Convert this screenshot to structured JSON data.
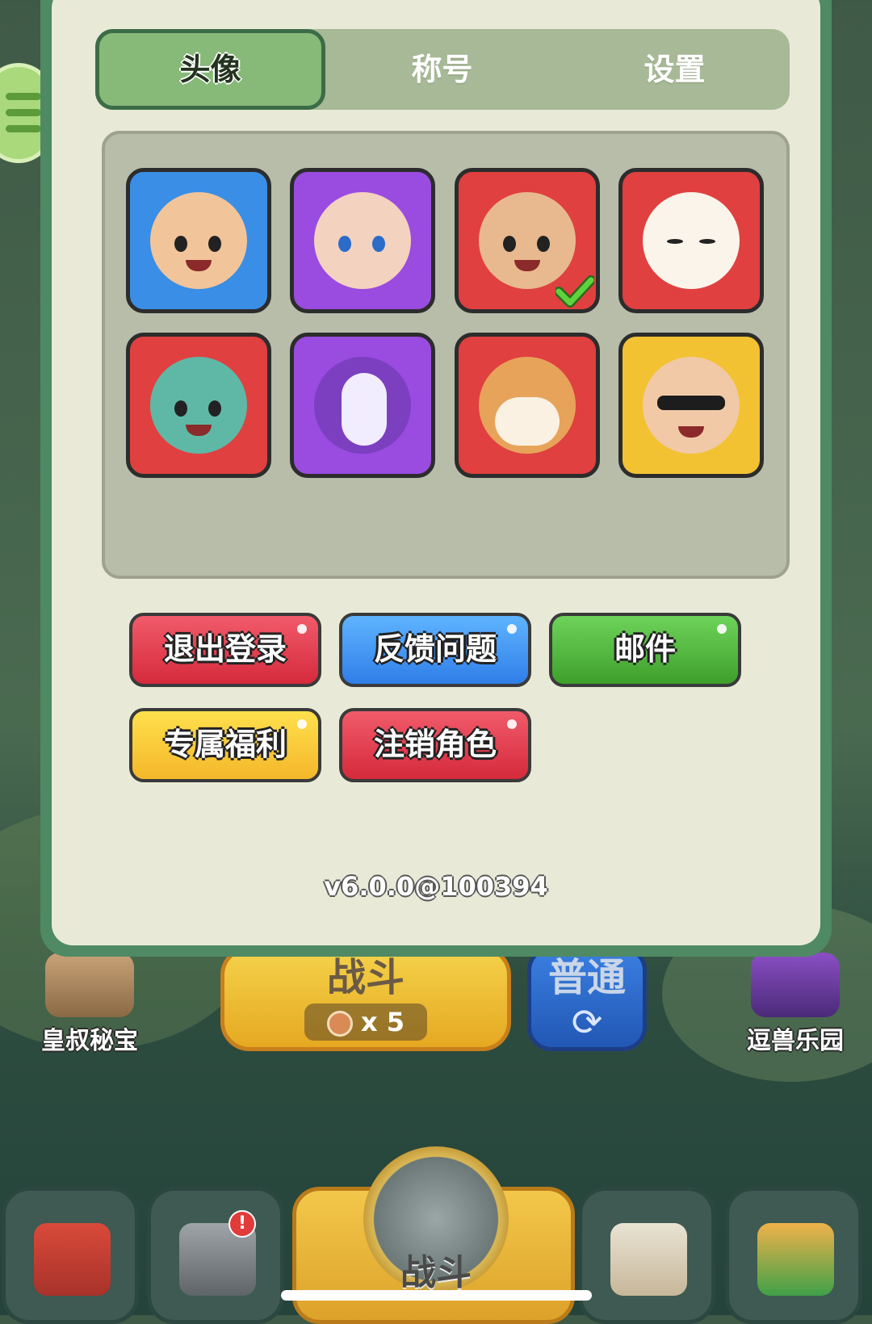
{
  "tabs": [
    {
      "label": "头像",
      "active": true
    },
    {
      "label": "称号",
      "active": false
    },
    {
      "label": "设置",
      "active": false
    }
  ],
  "avatars": [
    {
      "name": "general-green-headband",
      "bg": "#3a8ee6",
      "selected": false
    },
    {
      "name": "purple-hair-heroine",
      "bg": "#9a4be0",
      "selected": false
    },
    {
      "name": "red-horned-warrior",
      "bg": "#e04040",
      "selected": true
    },
    {
      "name": "lucky-cat",
      "bg": "#e04040",
      "selected": false
    },
    {
      "name": "dragon-hood-character",
      "bg": "#e04040",
      "selected": false
    },
    {
      "name": "unicorn",
      "bg": "#9a4be0",
      "selected": false
    },
    {
      "name": "corgi-face",
      "bg": "#e04040",
      "selected": false
    },
    {
      "name": "sunglasses-man",
      "bg": "#f2c232",
      "selected": false
    }
  ],
  "buttons": {
    "logout": "退出登录",
    "feedback": "反馈问题",
    "mail": "邮件",
    "benefits": "专属福利",
    "delete_role": "注销角色"
  },
  "version": "v6.0.0@100394",
  "game": {
    "left_feature": "皇叔秘宝",
    "right_feature": "逗兽乐园",
    "battle_label": "战斗",
    "battle_cost": "x 5",
    "mode_label": "普通",
    "center_nav_label": "战斗",
    "nav_badge": "!"
  }
}
